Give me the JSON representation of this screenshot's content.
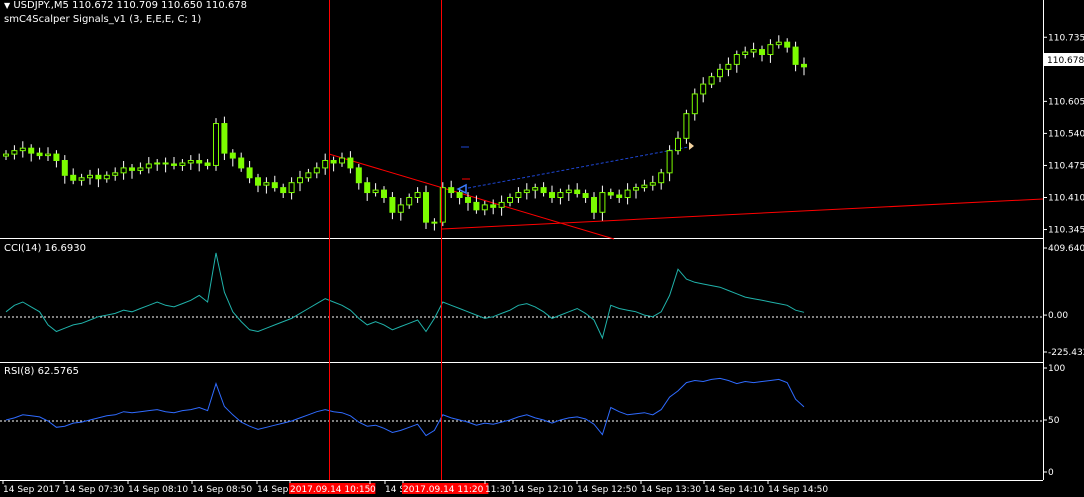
{
  "header": {
    "symbol_line": "USDJPY.,M5  110.672 110.709 110.650 110.678",
    "indicator_line": "smC4Scalper Signals_v1 (3, E,E,E, C; 1)"
  },
  "colors": {
    "background": "#000000",
    "bull": "#7CFC00",
    "bear": "#FFFFFF",
    "wick": "#FFFFFF",
    "separator": "#FFFFFF",
    "trendline": "#FF0000",
    "vline": "#FF0000",
    "signal_line": "#1E46D2",
    "cci_line": "#20B2AA",
    "rsi_line": "#2F6BFF",
    "level_line": "#FFFFFF"
  },
  "chart_data": [
    {
      "type": "candlestick",
      "pane": "price",
      "title": "USDJPY.,M5",
      "yticks": [
        "110.735",
        "110.678",
        "110.605",
        "110.540",
        "110.475",
        "110.410",
        "110.345"
      ],
      "ylim": [
        110.34,
        110.77
      ],
      "current_price": "110.678",
      "x_ticks": [
        "14 Sep 2017",
        "14 Sep 07:30",
        "14 Sep 08:10",
        "14 Sep 08:50",
        "14 Sep",
        "2017.09.14 10:15",
        "0",
        "14 Sep",
        "2017.09.14 11:20",
        "11:30",
        "14 Sep 12:10",
        "14 Sep 12:50",
        "14 Sep 13:30",
        "14 Sep 14:10",
        "14 Sep 14:50"
      ],
      "closes": [
        110.498,
        110.505,
        110.51,
        110.5,
        110.495,
        110.498,
        110.485,
        110.455,
        110.445,
        110.45,
        110.455,
        110.448,
        110.455,
        110.46,
        110.47,
        110.465,
        110.47,
        110.478,
        110.48,
        110.478,
        110.475,
        110.48,
        110.485,
        110.48,
        110.475,
        110.56,
        110.5,
        110.49,
        110.47,
        110.45,
        110.435,
        110.44,
        110.43,
        110.42,
        110.44,
        110.45,
        110.46,
        110.47,
        110.485,
        110.48,
        110.49,
        110.47,
        110.44,
        110.42,
        110.425,
        110.41,
        110.38,
        110.395,
        110.41,
        110.42,
        110.36,
        110.36,
        110.43,
        110.42,
        110.41,
        110.4,
        110.385,
        110.395,
        110.39,
        110.4,
        110.41,
        110.42,
        110.425,
        110.43,
        110.42,
        110.41,
        110.42,
        110.425,
        110.418,
        110.41,
        110.38,
        110.42,
        110.415,
        110.41,
        110.425,
        110.43,
        110.435,
        110.44,
        110.46,
        110.505,
        110.53,
        110.58,
        110.62,
        110.64,
        110.655,
        110.67,
        110.68,
        110.7,
        110.705,
        110.71,
        110.7,
        110.72,
        110.725,
        110.715,
        110.68,
        110.675
      ],
      "signal_marker": {
        "type": "arrow",
        "value": 110.428
      }
    },
    {
      "type": "line",
      "pane": "indicator",
      "title": "CCI(14) 16.6930",
      "yticks": [
        "409.6403",
        "0.00",
        "-225.432"
      ],
      "ylim": [
        -225.432,
        409.6403
      ],
      "level": 0,
      "values": [
        20,
        60,
        80,
        50,
        20,
        -60,
        -100,
        -80,
        -60,
        -50,
        -30,
        -10,
        0,
        10,
        30,
        20,
        40,
        60,
        80,
        60,
        50,
        70,
        90,
        120,
        80,
        380,
        140,
        20,
        -40,
        -90,
        -100,
        -80,
        -60,
        -40,
        -20,
        10,
        40,
        70,
        100,
        80,
        60,
        30,
        -20,
        -60,
        -40,
        -60,
        -90,
        -70,
        -50,
        -30,
        -100,
        -20,
        80,
        60,
        40,
        20,
        0,
        -20,
        -10,
        10,
        30,
        60,
        70,
        50,
        20,
        -20,
        0,
        20,
        40,
        10,
        -30,
        -140,
        60,
        40,
        30,
        20,
        0,
        -10,
        20,
        120,
        280,
        220,
        200,
        190,
        180,
        170,
        150,
        130,
        110,
        100,
        90,
        80,
        70,
        60,
        30,
        16.7
      ]
    },
    {
      "type": "line",
      "pane": "indicator",
      "title": "RSI(8) 62.5765",
      "yticks": [
        "100",
        "50",
        "0"
      ],
      "ylim": [
        0,
        100
      ],
      "level": 50,
      "values": [
        50,
        52,
        55,
        54,
        53,
        49,
        43,
        44,
        47,
        48,
        50,
        52,
        54,
        55,
        58,
        57,
        58,
        59,
        60,
        58,
        57,
        59,
        60,
        62,
        59,
        85,
        63,
        55,
        48,
        44,
        41,
        43,
        45,
        47,
        49,
        52,
        55,
        58,
        60,
        58,
        57,
        54,
        48,
        44,
        45,
        42,
        38,
        40,
        43,
        46,
        35,
        40,
        55,
        52,
        50,
        48,
        45,
        47,
        46,
        48,
        50,
        53,
        55,
        52,
        50,
        47,
        50,
        52,
        53,
        51,
        46,
        36,
        62,
        58,
        55,
        56,
        57,
        55,
        60,
        72,
        78,
        86,
        88,
        87,
        89,
        90,
        88,
        85,
        87,
        86,
        87,
        88,
        89,
        86,
        70,
        62.6
      ]
    }
  ]
}
